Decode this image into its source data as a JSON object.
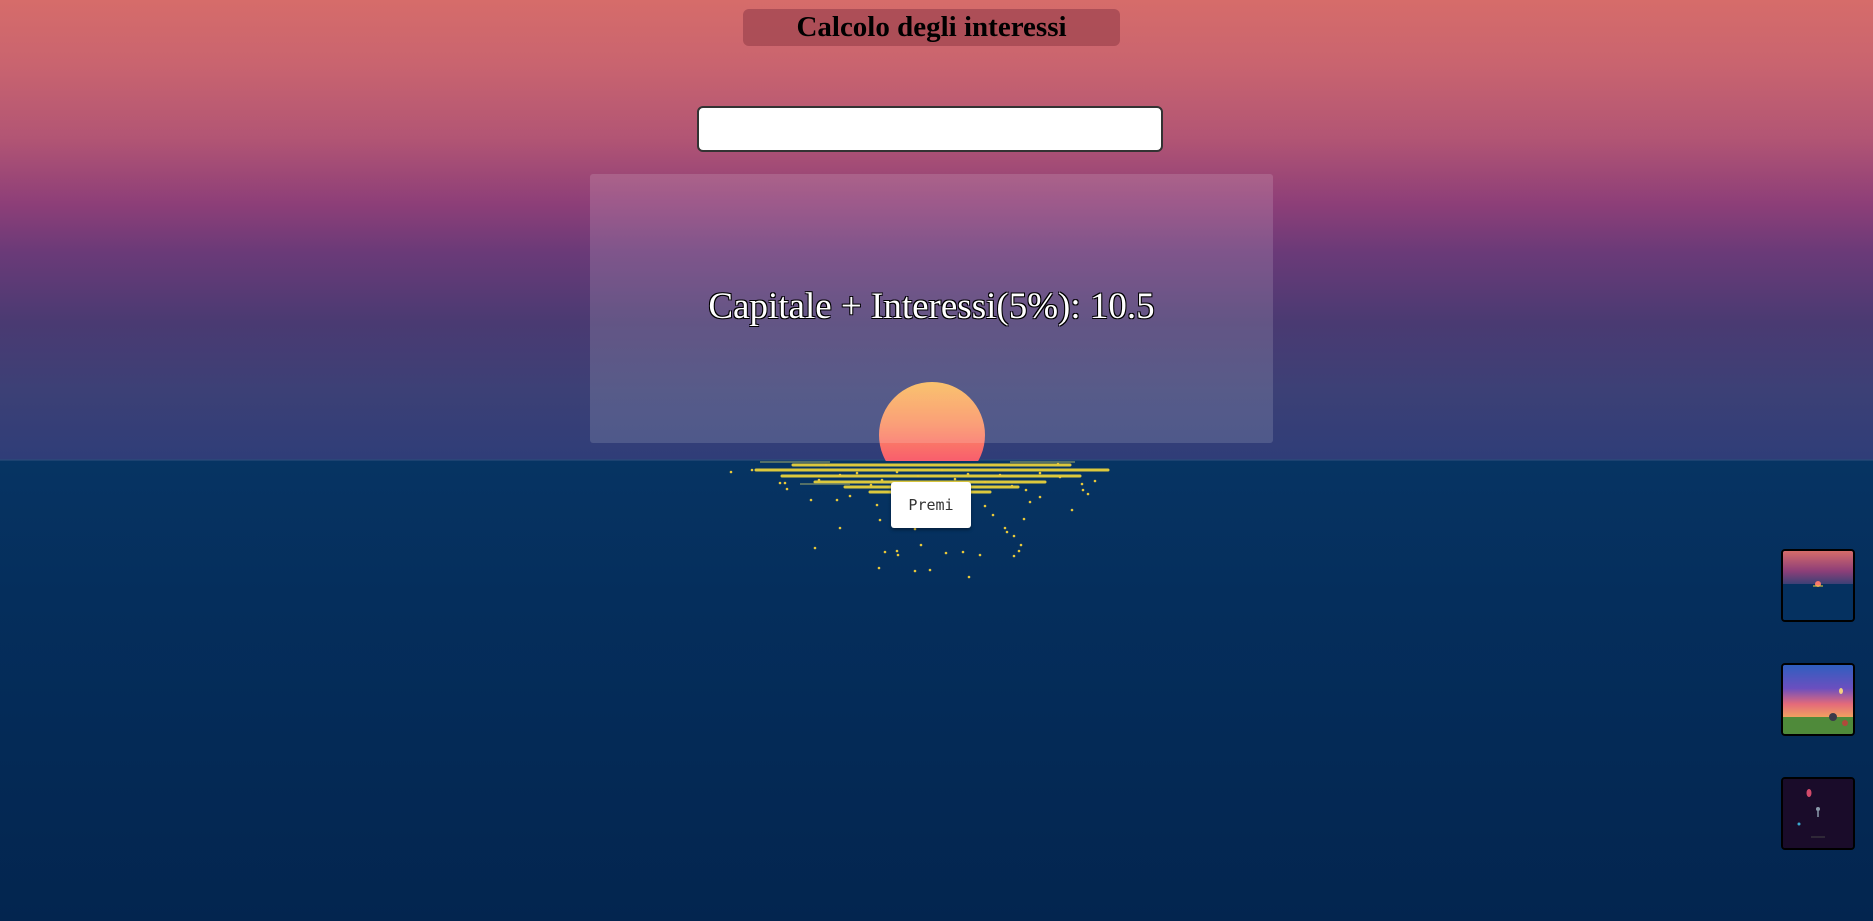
{
  "header": {
    "title": "Calcolo degli interessi"
  },
  "form": {
    "amount_value": "",
    "submit_label": "Premi"
  },
  "result": {
    "text": "Capitale + Interessi(5%): 10.5"
  },
  "theme_switcher": {
    "options": [
      {
        "icon": "sunset-sea-thumbnail"
      },
      {
        "icon": "meadow-sunset-thumbnail"
      },
      {
        "icon": "night-space-thumbnail"
      }
    ]
  },
  "colors": {
    "sky_top": "#d66c6a",
    "sky_bottom": "#2f3d78",
    "sea": "#052e5c",
    "sun": "#f9566f",
    "reflection": "#e8d23c"
  }
}
